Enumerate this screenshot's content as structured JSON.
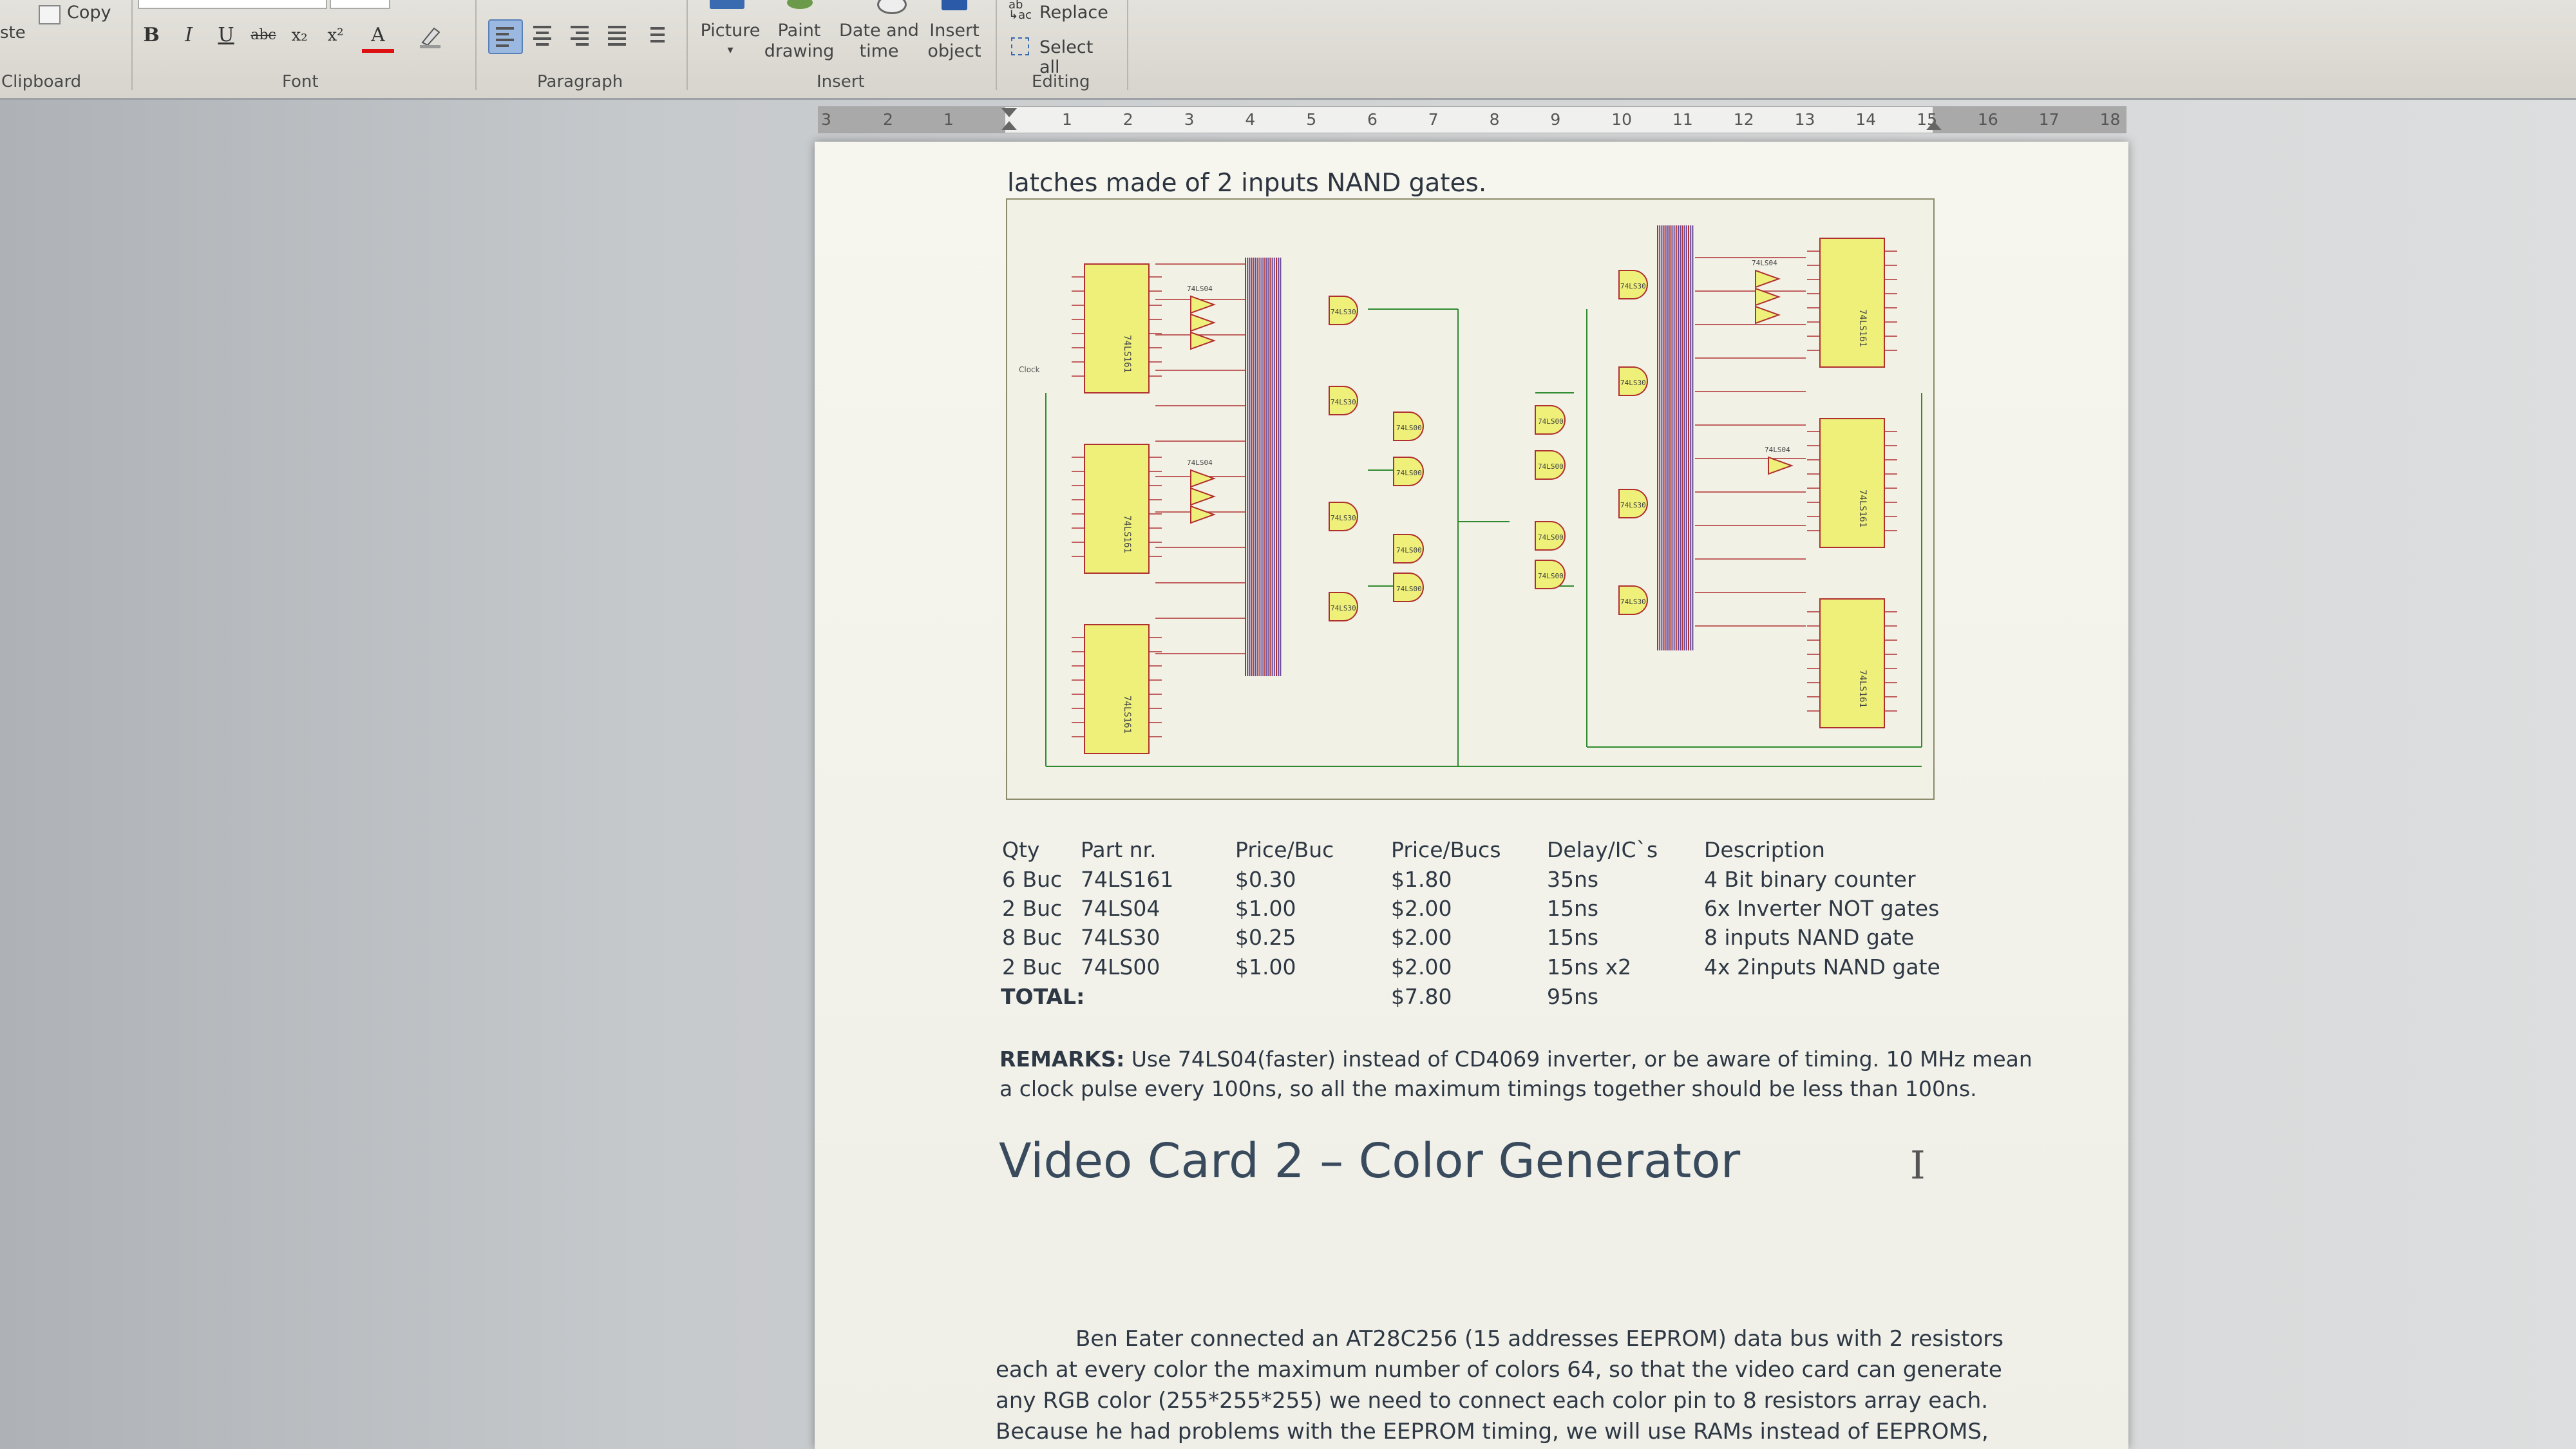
{
  "ribbon": {
    "clipboard": {
      "copy": "Copy",
      "paste_fragment": "ste",
      "group": "Clipboard"
    },
    "font": {
      "bold": "B",
      "italic": "I",
      "underline": "U",
      "strikethrough": "abc",
      "subscript": "x₂",
      "superscript": "x²",
      "font_color": "A",
      "group": "Font"
    },
    "paragraph": {
      "group": "Paragraph"
    },
    "insert": {
      "picture": "Picture",
      "paint_drawing_1": "Paint",
      "paint_drawing_2": "drawing",
      "date_time_1": "Date and",
      "date_time_2": "time",
      "insert_object_1": "Insert",
      "insert_object_2": "object",
      "group": "Insert"
    },
    "editing": {
      "replace": "Replace",
      "select_all": "Select all",
      "group": "Editing"
    }
  },
  "ruler": {
    "left_ticks": [
      "3",
      "2",
      "1"
    ],
    "ticks": [
      "1",
      "2",
      "3",
      "4",
      "5",
      "6",
      "7",
      "8",
      "9",
      "10",
      "11",
      "12",
      "13",
      "14",
      "15",
      "16",
      "17",
      "18"
    ]
  },
  "document": {
    "intro_line": "latches made of 2 inputs NAND gates.",
    "table": {
      "headers": [
        "Qty",
        "Part nr.",
        "Price/Buc",
        "Price/Bucs",
        "Delay/IC`s",
        "Description"
      ],
      "rows": [
        [
          "6 Buc",
          "74LS161",
          "$0.30",
          "$1.80",
          "35ns",
          "4 Bit binary counter"
        ],
        [
          "2 Buc",
          "74LS04",
          "$1.00",
          "$2.00",
          "15ns",
          "6x Inverter NOT gates"
        ],
        [
          "8 Buc",
          "74LS30",
          "$0.25",
          "$2.00",
          "15ns",
          "8 inputs NAND gate"
        ],
        [
          "2 Buc",
          "74LS00",
          "$1.00",
          "$2.00",
          "15ns x2",
          "4x 2inputs NAND gate"
        ]
      ],
      "total_label": "TOTAL:",
      "total_price": "$7.80",
      "total_delay": "95ns"
    },
    "remarks_label": "REMARKS:",
    "remarks_line1": " Use 74LS04(faster) instead of CD4069 inverter, or be aware of timing. 10 MHz mean",
    "remarks_line2": "a clock pulse every 100ns, so all the maximum timings together should be less than 100ns.",
    "heading": "Video Card 2 –  Color Generator",
    "body_lines": [
      "Ben Eater connected an AT28C256 (15 addresses EEPROM) data bus with 2 resistors",
      "each at every color the maximum number of colors 64, so that the video card can generate",
      "any RGB color (255*255*255) we need to connect each color pin to 8 resistors array each.",
      "Because he had problems with the EEPROM timing, we will use RAMs instead of EEPROMS,"
    ]
  },
  "schematic": {
    "chip_labels": [
      "74LS161",
      "74LS161",
      "74LS161",
      "74LS161",
      "74LS161",
      "74LS161"
    ],
    "inverter_labels": [
      "74LS04",
      "74LS04",
      "74LS04",
      "74LS04"
    ],
    "gate_labels": [
      "74LS00",
      "74LS00",
      "74LS00",
      "74LS00",
      "74LS00",
      "74LS00",
      "74LS00",
      "74LS00"
    ],
    "nand8_labels": [
      "74LS30",
      "74LS30",
      "74LS30",
      "74LS30",
      "74LS30",
      "74LS30",
      "74LS30",
      "74LS30"
    ],
    "clock_label": "Clock"
  },
  "colors": {
    "chip_fill": "#eef07a",
    "chip_stroke": "#b03030",
    "wire_green": "#2f8a2f",
    "bus_purple": "#6a4a9a",
    "heading": "#384a5c"
  }
}
